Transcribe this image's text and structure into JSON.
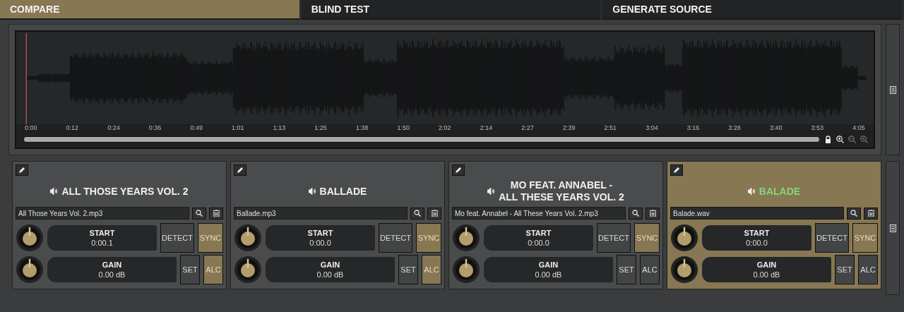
{
  "tabs": [
    {
      "label": "COMPARE",
      "selected": true
    },
    {
      "label": "BLIND TEST",
      "selected": false
    },
    {
      "label": "GENERATE SOURCE",
      "selected": false
    }
  ],
  "waveform": {
    "time_labels": [
      "0:00",
      "0:12",
      "0:24",
      "0:36",
      "0:49",
      "1:01",
      "1:13",
      "1:25",
      "1:38",
      "1:50",
      "2:02",
      "2:14",
      "2:27",
      "2:39",
      "2:51",
      "3:04",
      "3:16",
      "3:28",
      "3:40",
      "3:53",
      "4:05"
    ]
  },
  "sources": [
    {
      "title": "ALL THOSE YEARS VOL. 2",
      "file": "All Those Years Vol. 2.mp3",
      "start_label": "START",
      "start_value": "0:00.1",
      "gain_label": "GAIN",
      "gain_value": "0.00 dB",
      "detect": "DETECT",
      "sync": "SYNC",
      "sync_on": true,
      "set": "SET",
      "alc": "ALC",
      "alc_on": true,
      "selected": false
    },
    {
      "title": "BALLADE",
      "file": "Ballade.mp3",
      "start_label": "START",
      "start_value": "0:00.0",
      "gain_label": "GAIN",
      "gain_value": "0.00 dB",
      "detect": "DETECT",
      "sync": "SYNC",
      "sync_on": true,
      "set": "SET",
      "alc": "ALC",
      "alc_on": true,
      "selected": false
    },
    {
      "title": "MO FEAT. ANNABEL -\nALL THESE YEARS VOL. 2",
      "file": "Mo feat. Annabel - All These Years Vol. 2.mp3",
      "start_label": "START",
      "start_value": "0:00.0",
      "gain_label": "GAIN",
      "gain_value": "0.00 dB",
      "detect": "DETECT",
      "sync": "SYNC",
      "sync_on": true,
      "set": "SET",
      "alc": "ALC",
      "alc_on": false,
      "selected": false
    },
    {
      "title": "BALADE",
      "file": "Balade.wav",
      "start_label": "START",
      "start_value": "0:00.0",
      "gain_label": "GAIN",
      "gain_value": "0.00 dB",
      "detect": "DETECT",
      "sync": "SYNC",
      "sync_on": true,
      "set": "SET",
      "alc": "ALC",
      "alc_on": false,
      "selected": true
    }
  ]
}
